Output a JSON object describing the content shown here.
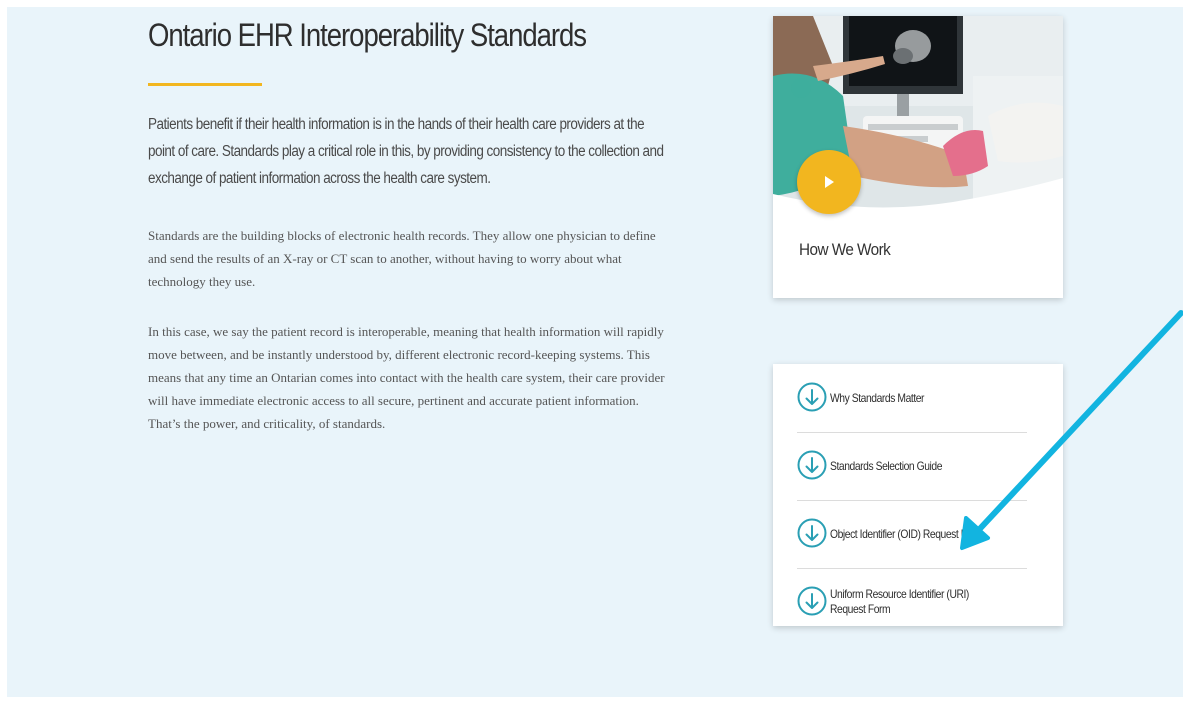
{
  "main": {
    "title": "Ontario EHR Interoperability Standards",
    "lead": "Patients benefit if their health information is in the hands of their health care providers at the point of care. Standards play a critical role in this, by providing consistency to the collection and exchange of patient information across the health care system.",
    "paragraphs": [
      "Standards are the building blocks of electronic health records. They allow one physician to define and send the results of an X-ray or CT scan to another, without having to worry about what technology they use.",
      "In this case, we say the patient record is interoperable, meaning that health information will rapidly move between, and be instantly understood by, different electronic record-keeping systems. This means that any time an Ontarian comes into contact with the health care system, their care provider will have immediate electronic access to all secure, pertinent and accurate patient information. That’s the power, and criticality, of standards."
    ]
  },
  "sidebar": {
    "video_card": {
      "caption": "How We Work",
      "play_icon": "play-icon"
    },
    "links": [
      {
        "label": "Why Standards Matter",
        "icon": "arrow-down-circle-icon"
      },
      {
        "label": "Standards Selection Guide",
        "icon": "arrow-down-circle-icon"
      },
      {
        "label": "Object Identifier (OID) Request Form",
        "icon": "arrow-down-circle-icon"
      },
      {
        "label": "Uniform Resource Identifier (URI) Request Form",
        "icon": "arrow-down-circle-icon"
      }
    ]
  },
  "colors": {
    "page_background": "#e9f4fa",
    "accent_yellow": "#f2b61f",
    "icon_teal": "#2a9fb4",
    "annotation_arrow": "#12b4e0"
  }
}
